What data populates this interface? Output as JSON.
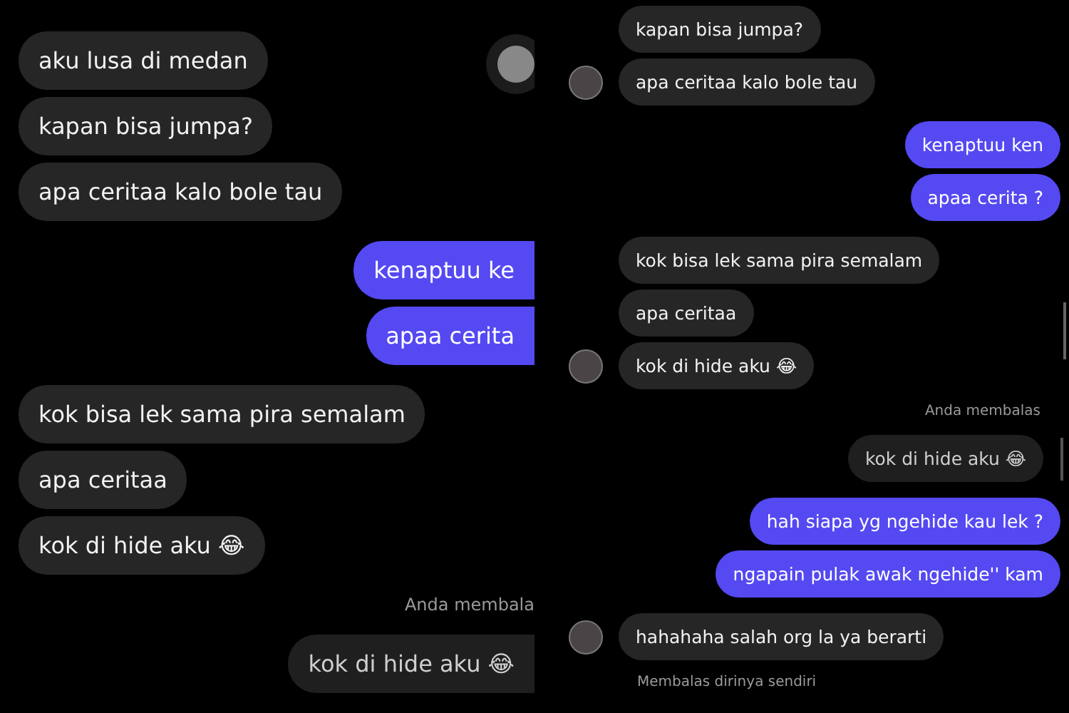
{
  "panels": [
    {
      "messages": [
        {
          "kind": "incoming",
          "text": "aku lusa di medan"
        },
        {
          "kind": "incoming",
          "text": "kapan bisa jumpa?"
        },
        {
          "kind": "incoming",
          "text": "apa ceritaa kalo bole tau"
        },
        {
          "kind": "outgoing",
          "text": "kenaptuu ke"
        },
        {
          "kind": "outgoing",
          "text": "apaa cerita"
        },
        {
          "kind": "incoming",
          "text": "kok bisa lek sama pira semalam"
        },
        {
          "kind": "incoming",
          "text": "apa ceritaa"
        },
        {
          "kind": "incoming",
          "text": "kok di hide aku 😂"
        },
        {
          "kind": "note",
          "text": "Anda membala"
        },
        {
          "kind": "quote",
          "text": "kok di hide aku 😂"
        }
      ]
    },
    {
      "messages": [
        {
          "kind": "incoming",
          "text": "kapan bisa jumpa?",
          "avatar": false
        },
        {
          "kind": "incoming",
          "text": "apa ceritaa kalo bole tau",
          "avatar": true
        },
        {
          "kind": "outgoing",
          "text": "kenaptuu ken"
        },
        {
          "kind": "outgoing",
          "text": "apaa cerita ?"
        },
        {
          "kind": "incoming",
          "text": "kok bisa lek sama pira semalam",
          "avatar": false
        },
        {
          "kind": "incoming",
          "text": "apa ceritaa",
          "avatar": false
        },
        {
          "kind": "incoming",
          "text": "kok di hide aku 😂",
          "avatar": true
        },
        {
          "kind": "note",
          "text": "Anda membalas"
        },
        {
          "kind": "quote",
          "text": "kok di hide aku 😂"
        },
        {
          "kind": "outgoing",
          "text": "hah siapa yg ngehide kau lek ?"
        },
        {
          "kind": "outgoing",
          "text": "ngapain pulak awak ngehide'' kam"
        },
        {
          "kind": "incoming",
          "text": "hahahaha salah org la ya berarti",
          "avatar": true
        },
        {
          "kind": "subnote",
          "text": "Membalas dirinya sendiri"
        }
      ]
    }
  ]
}
